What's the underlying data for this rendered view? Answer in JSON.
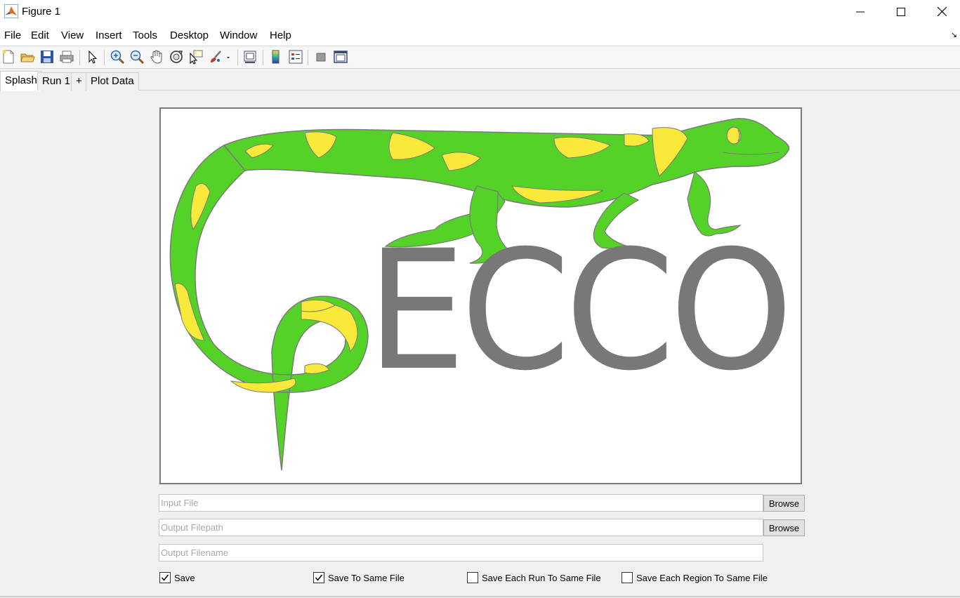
{
  "window": {
    "title": "Figure 1"
  },
  "menu": [
    "File",
    "Edit",
    "View",
    "Insert",
    "Tools",
    "Desktop",
    "Window",
    "Help"
  ],
  "tabs": [
    "Splash",
    "Run 1",
    "+",
    "Plot Data"
  ],
  "splash": {
    "logo_text": "ECCO"
  },
  "fields": {
    "input_file": {
      "placeholder": "Input File",
      "value": ""
    },
    "output_filepath": {
      "placeholder": "Output Filepath",
      "value": ""
    },
    "output_filename": {
      "placeholder": "Output Filename",
      "value": ""
    }
  },
  "buttons": {
    "browse_input": "Browse",
    "browse_output": "Browse"
  },
  "checkboxes": [
    {
      "label": "Save",
      "checked": true
    },
    {
      "label": "Save To Same File",
      "checked": true
    },
    {
      "label": "Save Each Run To Same File",
      "checked": false
    },
    {
      "label": "Save Each Region To Same File",
      "checked": false
    }
  ],
  "colors": {
    "gecko_green": "#55d227",
    "gecko_yellow": "#f8e93b",
    "logo_gray": "#787878"
  }
}
